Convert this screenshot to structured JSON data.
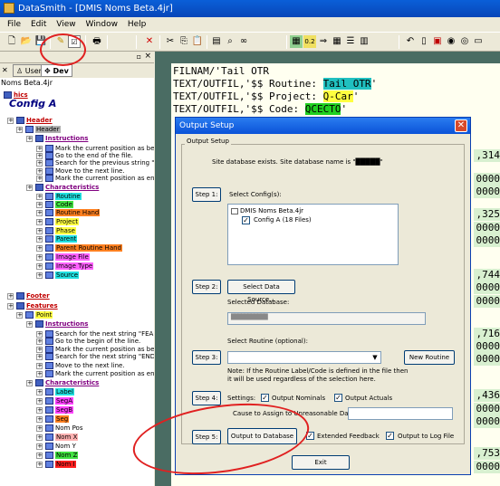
{
  "window": {
    "title": "DataSmith - [DMIS Noms Beta.4jr]"
  },
  "menu": [
    "File",
    "Edit",
    "View",
    "Window",
    "Help"
  ],
  "left_panel": {
    "tabs": {
      "user": "User",
      "dev": "Dev"
    },
    "tree_top": "Noms Beta.4jr",
    "section": "Config A",
    "items": [
      {
        "text": "hics",
        "indent": 0,
        "color": "#c00000",
        "style": "uhead"
      },
      {
        "text": "Header",
        "indent": 1,
        "color": "#c00000",
        "style": "uhead"
      },
      {
        "text": "Header",
        "indent": 2,
        "color": "",
        "bg": "#b0b0b0"
      },
      {
        "text": "Instructions",
        "indent": 3,
        "color": "#800080",
        "style": "uhead"
      },
      {
        "text": "Mark the current position as beg",
        "indent": 4
      },
      {
        "text": "Go to the end of the file.",
        "indent": 4
      },
      {
        "text": "Search for the previous string \"",
        "indent": 4
      },
      {
        "text": "Move to the next line.",
        "indent": 4
      },
      {
        "text": "Mark the current position as end",
        "indent": 4
      },
      {
        "text": "Characteristics",
        "indent": 3,
        "color": "#800080",
        "style": "uhead"
      },
      {
        "text": "Routine",
        "indent": 4,
        "bg": "#20e0e0"
      },
      {
        "text": "Code",
        "indent": 4,
        "bg": "#40e040"
      },
      {
        "text": "Routine Hand",
        "indent": 4,
        "bg": "#ff8020"
      },
      {
        "text": "Project",
        "indent": 4,
        "bg": "#ffff40"
      },
      {
        "text": "Phase",
        "indent": 4,
        "bg": "#ffff40"
      },
      {
        "text": "Parent",
        "indent": 4,
        "bg": "#20e0e0"
      },
      {
        "text": "Parent Routine Hand",
        "indent": 4,
        "bg": "#ff8020"
      },
      {
        "text": "Image File",
        "indent": 4,
        "bg": "#ff60ff"
      },
      {
        "text": "Image Type",
        "indent": 4,
        "bg": "#ff60ff"
      },
      {
        "text": "Source",
        "indent": 4,
        "bg": "#20e0e0"
      },
      {
        "text": "Footer",
        "indent": 1,
        "color": "#c00000",
        "style": "uhead"
      },
      {
        "text": "Features",
        "indent": 1,
        "color": "#c00000",
        "style": "uhead"
      },
      {
        "text": "Point",
        "indent": 2,
        "bg": "#ffff40"
      },
      {
        "text": "Instructions",
        "indent": 3,
        "color": "#800080",
        "style": "uhead"
      },
      {
        "text": "Search for the next string \"FEA",
        "indent": 4
      },
      {
        "text": "Go to the begin of the line.",
        "indent": 4
      },
      {
        "text": "Mark the current position as beg",
        "indent": 4
      },
      {
        "text": "Search for the next string \"END",
        "indent": 4
      },
      {
        "text": "Move to the next line.",
        "indent": 4
      },
      {
        "text": "Mark the current position as end",
        "indent": 4
      },
      {
        "text": "Characteristics",
        "indent": 3,
        "color": "#800080",
        "style": "uhead"
      },
      {
        "text": "Label",
        "indent": 4,
        "bg": "#20e0e0"
      },
      {
        "text": "SegA",
        "indent": 4,
        "bg": "#ff40ff"
      },
      {
        "text": "SegB",
        "indent": 4,
        "bg": "#ff40ff"
      },
      {
        "text": "Seg",
        "indent": 4,
        "bg": "#ff8020"
      },
      {
        "text": "Nom Pos",
        "indent": 4
      },
      {
        "text": "Nom X",
        "indent": 4,
        "bg": "#ffb0b0"
      },
      {
        "text": "Nom Y",
        "indent": 4
      },
      {
        "text": "Nom Z",
        "indent": 4,
        "bg": "#40e040"
      },
      {
        "text": "Nom I",
        "indent": 4,
        "bg": "#ff2020"
      }
    ]
  },
  "code": {
    "lines": [
      {
        "pre": "FILNAM/'Tail OTR",
        "hl": "",
        "post": ""
      },
      {
        "pre": "TEXT/OUTFIL,'$$ Routine: ",
        "hl": "Tail OTR",
        "post": "'",
        "hlc": "hlc"
      },
      {
        "pre": "TEXT/OUTFIL,'$$ Project: ",
        "hl": "Q-Car",
        "post": "'",
        "hlc": "hly"
      },
      {
        "pre": "TEXT/OUTFIL,'$$ Code: ",
        "hl": "QCECTO",
        "post": "'",
        "hlc": "hlg"
      }
    ],
    "right_numbers": [
      ",314",
      "0000",
      "0000",
      ",325",
      "0000",
      "0000",
      ",744",
      "0000",
      "0000",
      ",716",
      "0000",
      "0000",
      ",436",
      "0000",
      "0000",
      ",753",
      "0000"
    ],
    "bottom_line": "TEXT/OUTFIL,'$$ Code: ..."
  },
  "dialog": {
    "title": "Output Setup",
    "group_label": "Output Setup",
    "db_status": "Site database exists.  Site database name is \"█████\"",
    "step1": {
      "button": "Step 1:",
      "label": "Select Config(s):"
    },
    "config_list": {
      "root": "DMIS Noms Beta.4jr",
      "child": "Config A (18 Files)"
    },
    "step2": {
      "button": "Step 2:",
      "action": "Select Data Source...",
      "selected_label": "Selected Database:",
      "selected_value": "███████████"
    },
    "routine_label": "Select Routine (optional):",
    "step3": {
      "button": "Step 3:",
      "new_routine": "New Routine",
      "note": "Note: If the Routine Label/Code is defined in the file then it will be used regardless of the selection here."
    },
    "step4": {
      "button": "Step 4:",
      "settings": "Settings:",
      "output_nominals": "Output Nominals",
      "output_actuals": "Output Actuals",
      "cause_label": "Cause to Assign to Unreasonable Data:"
    },
    "step5": {
      "button": "Step 5:",
      "output_db": "Output to Database",
      "extended_feedback": "Extended Feedback",
      "output_log": "Output to Log File"
    },
    "exit": "Exit"
  }
}
